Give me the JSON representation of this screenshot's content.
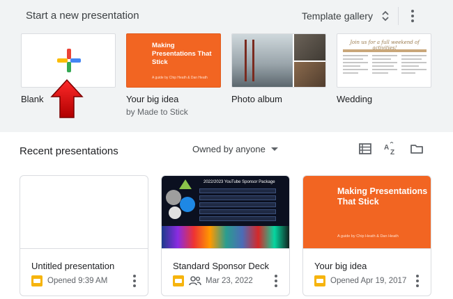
{
  "header": {
    "title": "Start a new presentation",
    "gallery_label": "Template gallery"
  },
  "templates": [
    {
      "name": "Blank",
      "sub": ""
    },
    {
      "name": "Your big idea",
      "sub": "by Made to Stick",
      "thumb_title": "Making Presentations That Stick",
      "thumb_author": "A guide by Chip Heath & Dan Heath"
    },
    {
      "name": "Photo album",
      "sub": ""
    },
    {
      "name": "Wedding",
      "sub": "",
      "thumb_title": "Join us for a full weekend of activities!"
    }
  ],
  "recent": {
    "title": "Recent presentations",
    "owner_filter": "Owned by anyone",
    "cards": [
      {
        "title": "Untitled presentation",
        "meta": "Opened 9:39 AM",
        "shared": false
      },
      {
        "title": "Standard Sponsor Deck",
        "meta": "Mar 23, 2022",
        "shared": true,
        "thumb_title": "2022/2023 YouTube Sponsor Package"
      },
      {
        "title": "Your big idea",
        "meta": "Opened Apr 19, 2017",
        "shared": false,
        "thumb_title": "Making Presentations That Stick",
        "thumb_author": "A guide by Chip Heath & Dan Heath"
      }
    ]
  },
  "colors": {
    "accent_orange": "#f26522",
    "slides_yellow": "#f6b40e",
    "annotation_arrow": "#e00000"
  },
  "icons": [
    "sort-icon",
    "more-vert-icon",
    "list-view-icon",
    "sort-az-icon",
    "folder-icon",
    "people-icon",
    "slides-file-icon"
  ]
}
